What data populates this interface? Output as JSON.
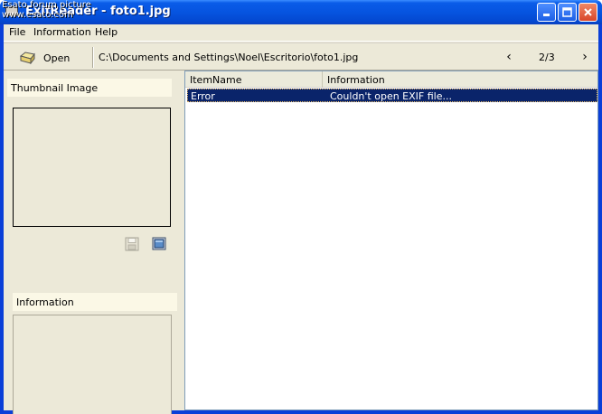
{
  "window": {
    "title": "ExifReader - foto1.jpg",
    "watermark_line1": "Esato forum picture",
    "watermark_line2": "www.esato.com"
  },
  "menu": [
    "File",
    "Information",
    "Help"
  ],
  "toolbar": {
    "open_label": "Open",
    "path": "C:\\Documents and Settings\\Noel\\Escritorio\\foto1.jpg",
    "prev_label": "‹",
    "page": "2/3",
    "next_label": "›"
  },
  "left_panel": {
    "thumbnail_header": "Thumbnail Image",
    "information_header": "Information"
  },
  "list": {
    "columns": [
      "ItemName",
      "Information"
    ],
    "rows": [
      {
        "item": "Error",
        "info": "Couldn't open EXIF file..."
      }
    ]
  },
  "colors": {
    "titlebar": "#0654e0",
    "client_bg": "#ece9d8",
    "selected_row": "#0a246a",
    "header_bg": "#fbf8e6"
  }
}
